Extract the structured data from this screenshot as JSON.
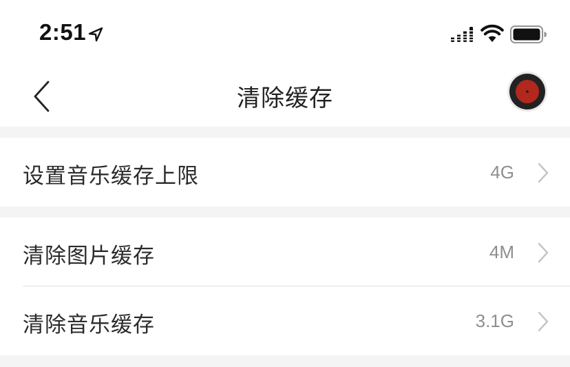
{
  "status_bar": {
    "time": "2:51",
    "icons": [
      "location-arrow-icon",
      "signal-icon",
      "wifi-icon",
      "battery-icon"
    ]
  },
  "nav": {
    "back_icon": "chevron-left-icon",
    "title": "清除缓存",
    "right_icon": "playing-disc-icon"
  },
  "settings": {
    "cache_limit": {
      "label": "设置音乐缓存上限",
      "value": "4G"
    },
    "clear_images": {
      "label": "清除图片缓存",
      "value": "4M"
    },
    "clear_music": {
      "label": "清除音乐缓存",
      "value": "3.1G"
    }
  },
  "colors": {
    "background": "#f4f4f4",
    "disc_red": "#b2281e",
    "disc_dark": "#222222",
    "secondary_text": "#8e8e8e"
  }
}
